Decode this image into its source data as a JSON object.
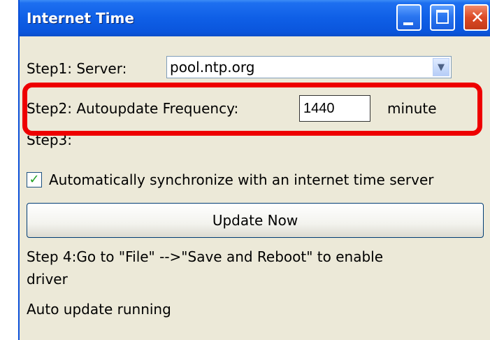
{
  "window": {
    "title": "Internet Time"
  },
  "titlebar": {
    "minimize_icon": "minimize-icon",
    "maximize_icon": "maximize-icon",
    "close_icon": "close-icon"
  },
  "step1": {
    "label": "Step1: Server:",
    "server_value": "pool.ntp.org"
  },
  "step2": {
    "label": "Step2: Autoupdate Frequency:",
    "frequency_value": "1440",
    "unit": "minute",
    "highlight_color": "#ee0000"
  },
  "step3": {
    "label": "Step3:",
    "checkbox_checked": true,
    "checkbox_label": "Automatically synchronize with an internet time server"
  },
  "update_button": {
    "label": "Update Now"
  },
  "step4": {
    "text_line1": "Step 4:Go to \"File\" -->\"Save and Reboot\" to enable",
    "text_line2": "driver"
  },
  "status": {
    "text": "Auto update running"
  }
}
